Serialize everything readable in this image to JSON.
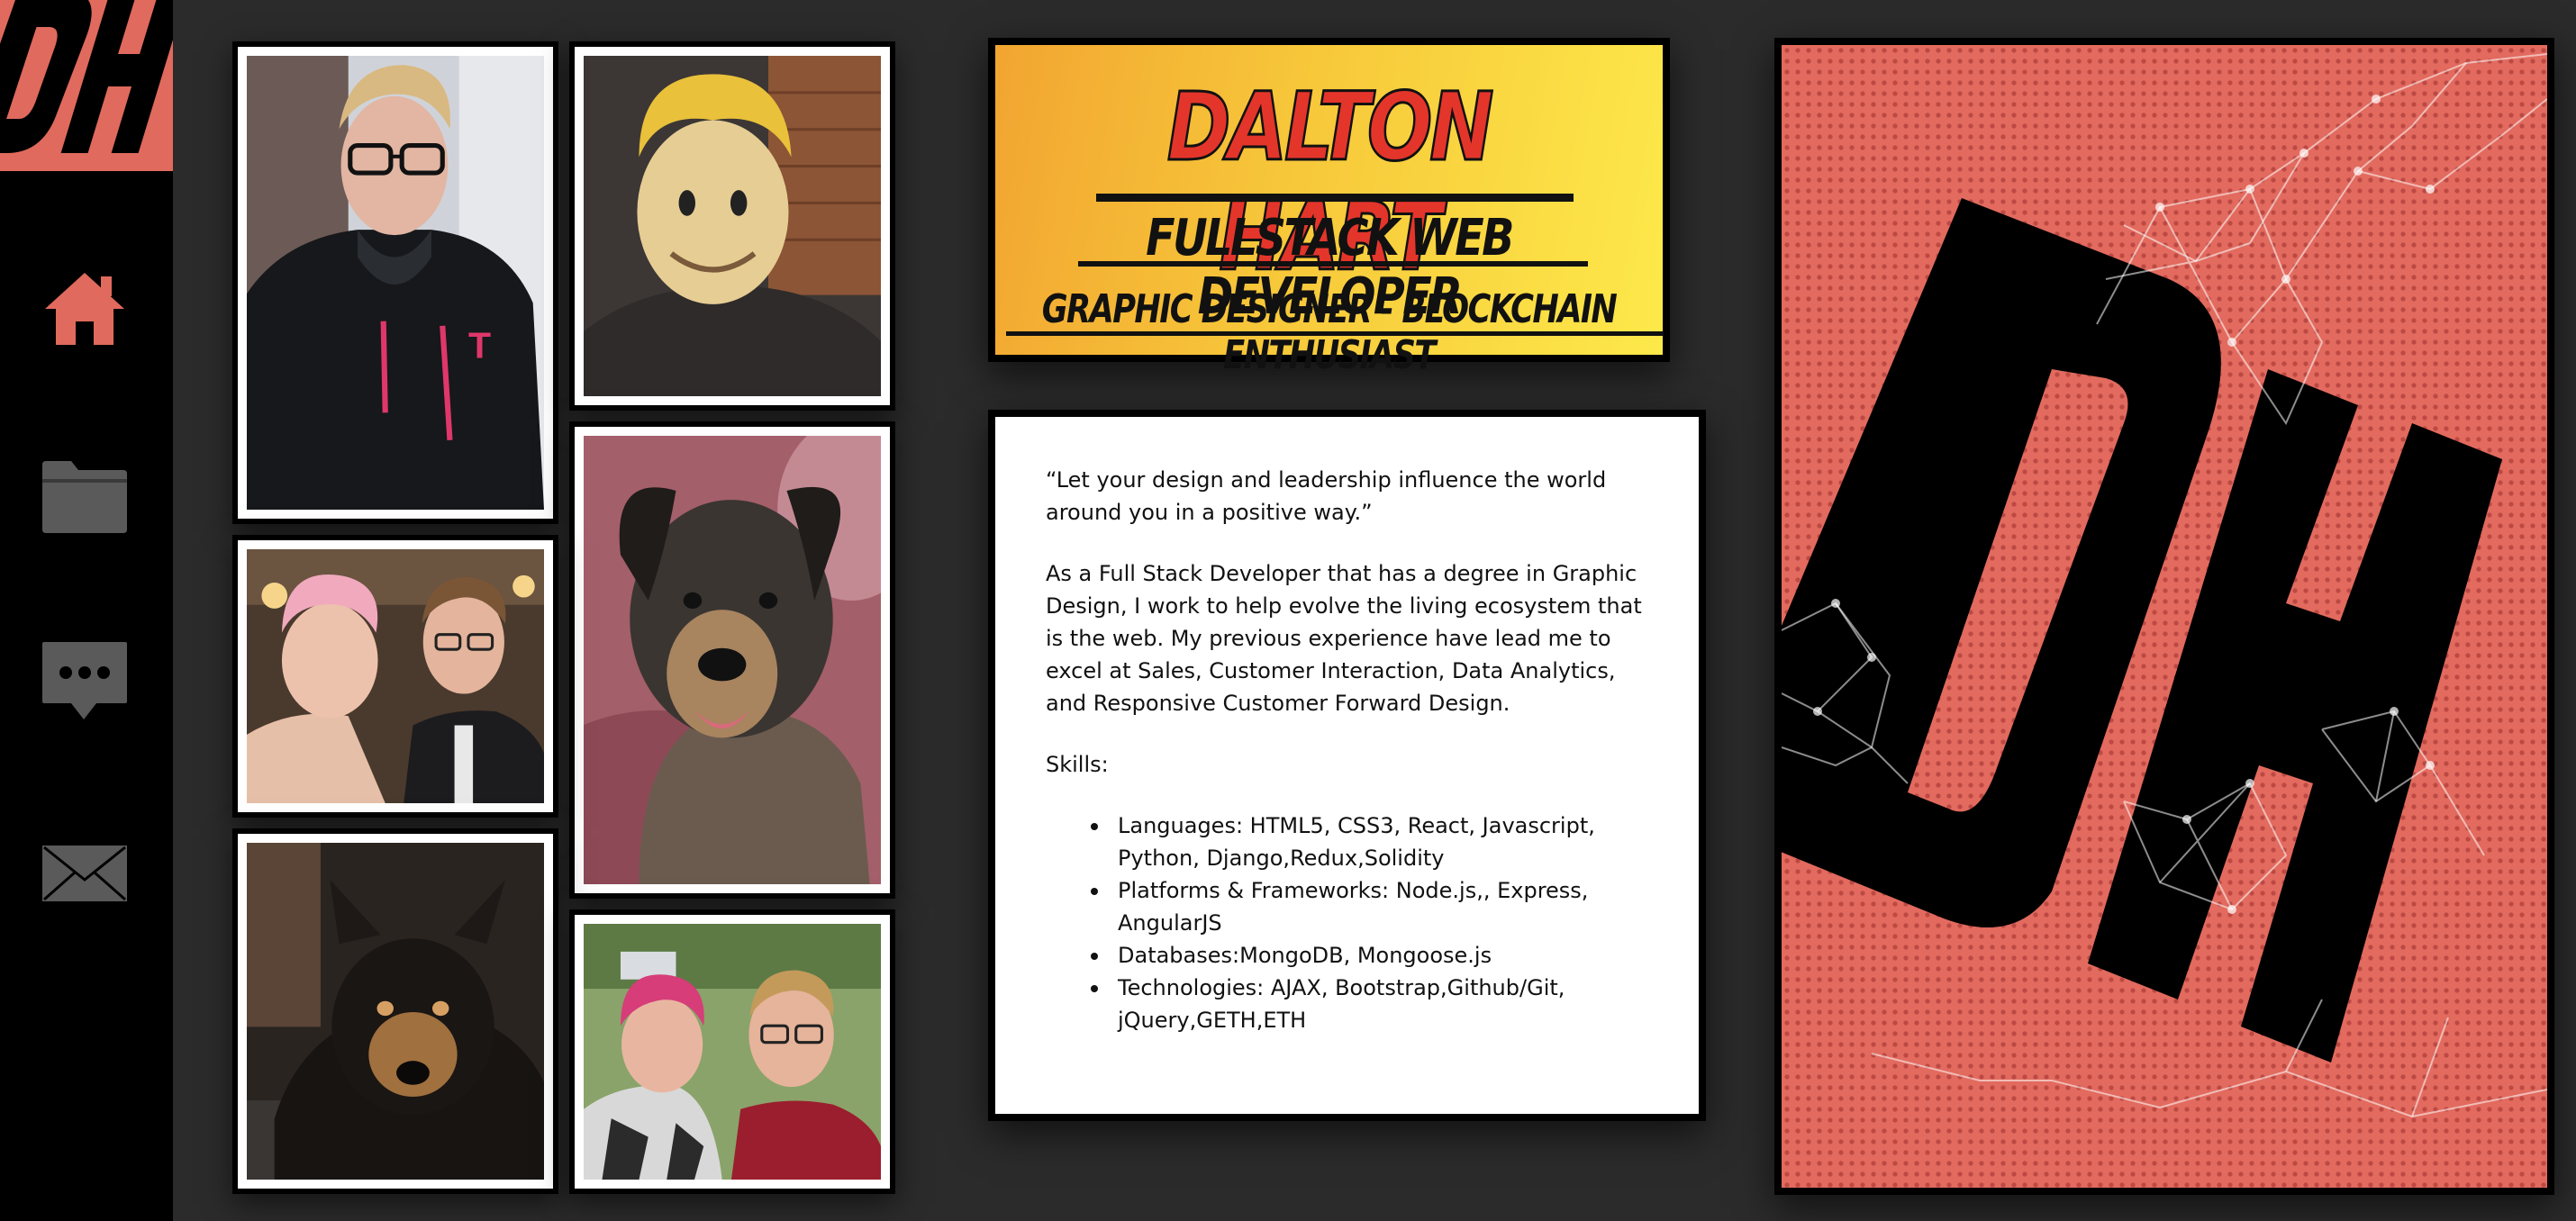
{
  "app": {
    "accent_color": "#e06a5d"
  },
  "sidebar": {
    "logo_text": "DH",
    "items": [
      {
        "name": "home",
        "icon": "home-icon",
        "color": "#e06a5d"
      },
      {
        "name": "portfolio",
        "icon": "folder-icon",
        "color": "#5a5a5a"
      },
      {
        "name": "chat",
        "icon": "chat-icon",
        "color": "#5a5a5a"
      },
      {
        "name": "contact",
        "icon": "mail-icon",
        "color": "#5a5a5a"
      }
    ]
  },
  "gallery": {
    "photos": [
      {
        "name": "photo-portrait-glasses"
      },
      {
        "name": "photo-bobblehead-mask"
      },
      {
        "name": "photo-dog-sitting"
      },
      {
        "name": "photo-couple-formal"
      },
      {
        "name": "photo-dog-lying"
      },
      {
        "name": "photo-couple-outdoor"
      }
    ]
  },
  "header": {
    "name": "DALTON HART",
    "role": "FULLSTACK WEB DEVELOPER",
    "subtitle": "GRAPHIC DESIGNER - BLOCKCHAIN ENTHUSIAST"
  },
  "about": {
    "quote": "“Let your design and leadership influence the world around you in a positive way.”",
    "bio": "As a Full Stack Developer that has a degree in Graphic Design, I work to help evolve the living ecosystem that is the web. My previous experience have lead me to excel at Sales, Customer Interaction, Data Analytics, and Responsive Customer Forward Design.",
    "skills_heading": "Skills:",
    "skills": [
      "Languages: HTML5, CSS3, React, Javascript, Python, Django,Redux,Solidity",
      "Platforms & Frameworks: Node.js,, Express, AngularJS",
      "Databases:MongoDB, Mongoose.js",
      "Technologies: AJAX, Bootstrap,Github/Git, jQuery,GETH,ETH"
    ]
  },
  "poster": {
    "logo_text": "DH"
  }
}
